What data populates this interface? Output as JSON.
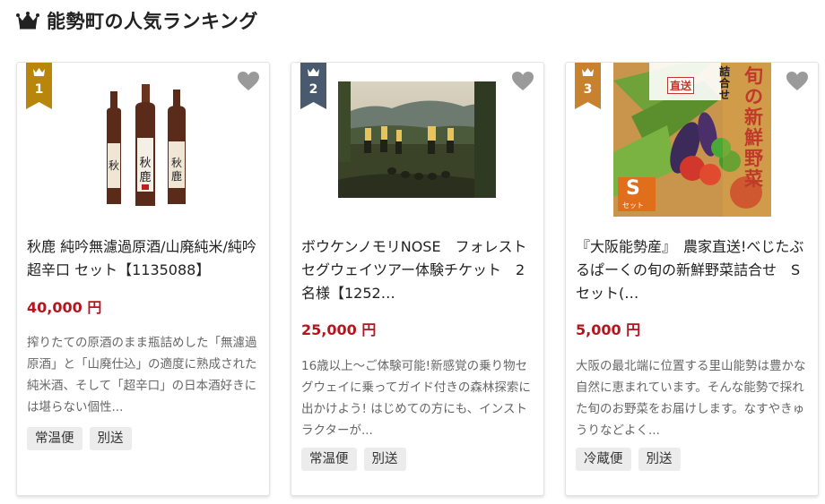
{
  "header": {
    "title": "能勢町の人気ランキング",
    "icon": "crown-icon"
  },
  "colors": {
    "gold": "#b8860b",
    "blue": "#4a5a6e",
    "bronze": "#c8812f",
    "price": "#b4161f"
  },
  "items": [
    {
      "rank": "1",
      "title": "秋鹿 純吟無濾過原酒/山廃純米/純吟超辛口 セット【1135088】",
      "price": "40,000 円",
      "description": "搾りたての原酒のまま瓶詰めした「無濾過原酒」と「山廃仕込」の適度に熟成された純米酒、そして「超辛口」の日本酒好きには堪らない個性...",
      "tags": [
        "常温便",
        "別送"
      ],
      "image": "sake-bottles-image"
    },
    {
      "rank": "2",
      "title": "ボウケンノモリNOSE　フォレストセグウェイツアー体験チケット　2名様【1252…",
      "price": "25,000 円",
      "description": "16歳以上～ご体験可能!新感覚の乗り物セグウェイに乗ってガイド付きの森林探索に出かけよう! はじめての方にも、インストラクターが...",
      "tags": [
        "常温便",
        "別送"
      ],
      "image": "segway-tour-image"
    },
    {
      "rank": "3",
      "title": "『大阪能勢産』　農家直送!べじたぶるぱーくの旬の新鮮野菜詰合せ　Sセット(…",
      "price": "5,000 円",
      "description": "大阪の最北端に位置する里山能勢は豊かな自然に恵まれています。そんな能勢で採れた旬のお野菜をお届けします。なすやきゅうりなどよく...",
      "tags": [
        "冷蔵便",
        "別送"
      ],
      "image": "vegetable-box-image",
      "image_text": {
        "vertical1": "詰合せ",
        "vertical2": "旬の新鮮野菜",
        "badge": "S",
        "badge_sub": "セット",
        "label": "直送"
      }
    }
  ]
}
